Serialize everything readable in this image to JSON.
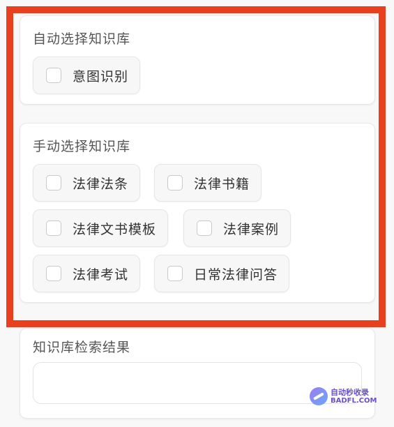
{
  "auto_section": {
    "title": "自动选择知识库",
    "options": [
      {
        "label": "意图识别",
        "checked": false
      }
    ]
  },
  "manual_section": {
    "title": "手动选择知识库",
    "options": [
      {
        "label": "法律法条",
        "checked": false
      },
      {
        "label": "法律书籍",
        "checked": false
      },
      {
        "label": "法律文书模板",
        "checked": false
      },
      {
        "label": "法律案例",
        "checked": false
      },
      {
        "label": "法律考试",
        "checked": false
      },
      {
        "label": "日常法律问答",
        "checked": false
      }
    ]
  },
  "results_section": {
    "title": "知识库检索结果",
    "value": ""
  },
  "watermark": {
    "line1": "自动秒收录",
    "line2": "BADFL.COM"
  },
  "colors": {
    "highlight_border": "#e8401f",
    "panel_background": "#ffffff",
    "page_background": "#f8f8f9"
  }
}
